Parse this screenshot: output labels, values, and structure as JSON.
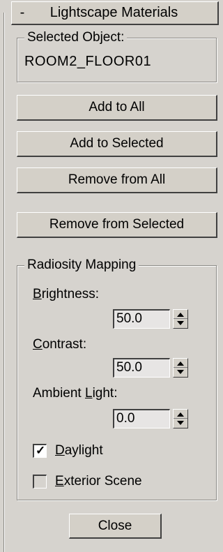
{
  "rollout": {
    "collapse_symbol": "-",
    "title": "Lightscape Materials"
  },
  "selected_object": {
    "legend": "Selected Object:",
    "value": "ROOM2_FLOOR01"
  },
  "buttons": {
    "add_to_all": "Add to All",
    "add_to_selected": "Add to Selected",
    "remove_from_all": "Remove from All",
    "remove_from_selected": "Remove from Selected",
    "close": "Close"
  },
  "radiosity_mapping": {
    "legend": "Radiosity Mapping",
    "brightness": {
      "label_first": "B",
      "label_rest": "rightness:",
      "value": "50.0"
    },
    "contrast": {
      "label_first": "C",
      "label_rest": "ontrast:",
      "value": "50.0"
    },
    "ambient_light": {
      "label_pre": "Ambient ",
      "label_u": "L",
      "label_rest": "ight:",
      "value": "0.0"
    },
    "daylight": {
      "label_first": "D",
      "label_rest": "aylight",
      "checked": true
    },
    "exterior_scene": {
      "label_first": "E",
      "label_rest": "xterior Scene",
      "checked": false
    }
  }
}
